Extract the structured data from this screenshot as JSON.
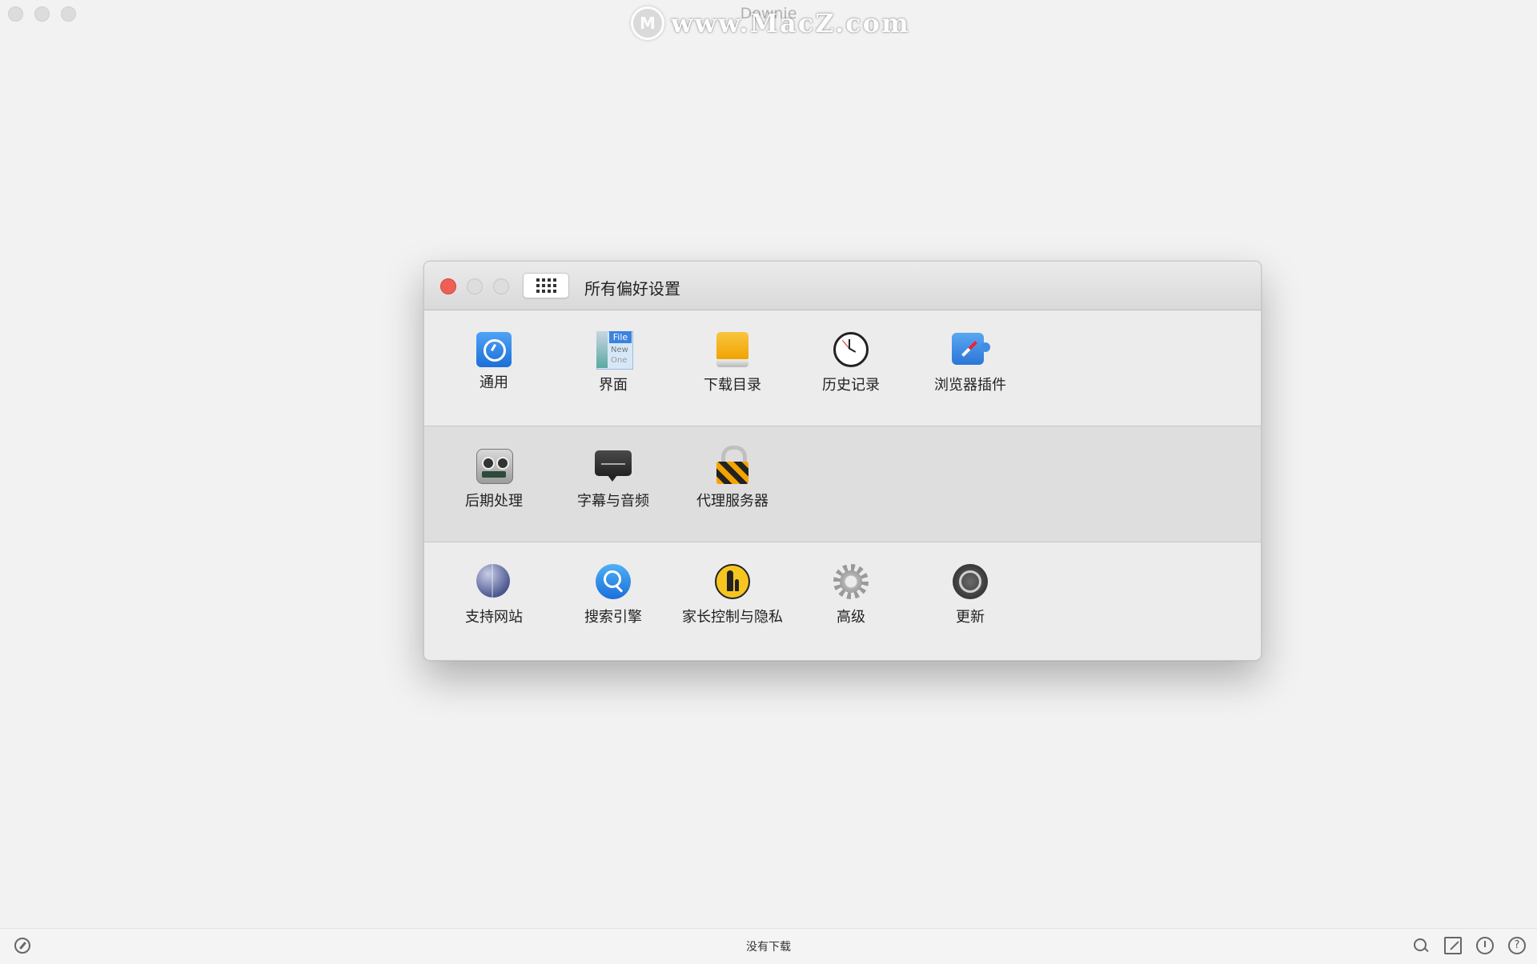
{
  "app": {
    "title": "Downie",
    "watermark_logo": "M",
    "watermark_text": "www.MacZ.com"
  },
  "prefs_window": {
    "title": "所有偏好设置",
    "rows": [
      [
        {
          "label": "通用",
          "icon": "general-gear-icon"
        },
        {
          "label": "界面",
          "icon": "interface-icon"
        },
        {
          "label": "下载目录",
          "icon": "download-folder-drive-icon"
        },
        {
          "label": "历史记录",
          "icon": "clock-icon"
        },
        {
          "label": "浏览器插件",
          "icon": "browser-plugin-icon"
        }
      ],
      [
        {
          "label": "后期处理",
          "icon": "robot-icon"
        },
        {
          "label": "字幕与音频",
          "icon": "subtitles-bubble-icon"
        },
        {
          "label": "代理服务器",
          "icon": "lock-icon"
        }
      ],
      [
        {
          "label": "支持网站",
          "icon": "globe-icon"
        },
        {
          "label": "搜索引擎",
          "icon": "search-icon"
        },
        {
          "label": "家长控制与隐私",
          "icon": "parental-control-icon"
        },
        {
          "label": "高级",
          "icon": "gear-icon"
        },
        {
          "label": "更新",
          "icon": "update-gear-icon"
        }
      ]
    ],
    "ui_icon_text": {
      "file": "File",
      "new": "New",
      "one": "One"
    }
  },
  "statusbar": {
    "text": "没有下载",
    "help_glyph": "?"
  },
  "colors": {
    "close": "#ee5f56",
    "accent_blue": "#2b76d6",
    "window_bg": "#f2f2f2"
  }
}
